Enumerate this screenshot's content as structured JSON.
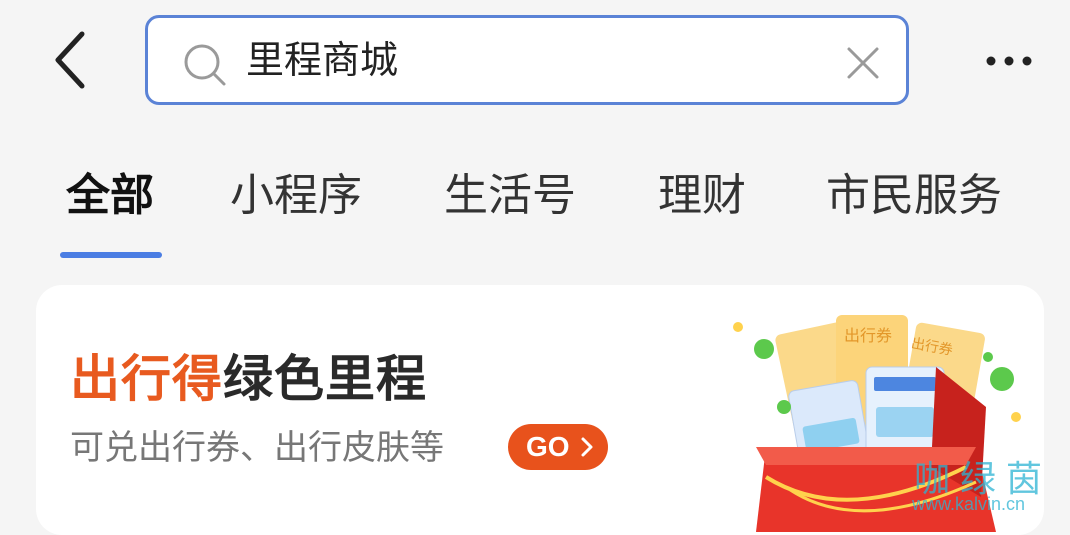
{
  "header": {
    "back_icon": "chevron-left-icon",
    "search": {
      "value": "里程商城",
      "icon": "search-icon",
      "clear_icon": "close-icon"
    },
    "more_icon": "more-horizontal-icon"
  },
  "tabs": [
    {
      "label": "全部",
      "active": true
    },
    {
      "label": "小程序",
      "active": false
    },
    {
      "label": "生活号",
      "active": false
    },
    {
      "label": "理财",
      "active": false
    },
    {
      "label": "市民服务",
      "active": false
    }
  ],
  "banner": {
    "title_highlight": "出行得",
    "title_rest": "绿色里程",
    "subtitle": "可兑出行券、出行皮肤等",
    "go_label": "GO",
    "art": {
      "coupon_label_1": "出行券",
      "coupon_label_2": "出行券"
    }
  },
  "watermark": {
    "name": "咖绿茵",
    "url": "www.kalvin.cn"
  },
  "colors": {
    "accent_blue": "#4a7de3",
    "search_border": "#5b83d6",
    "orange": "#e85a1f",
    "go_button": "#e8521c",
    "background": "#f5f5f5"
  }
}
